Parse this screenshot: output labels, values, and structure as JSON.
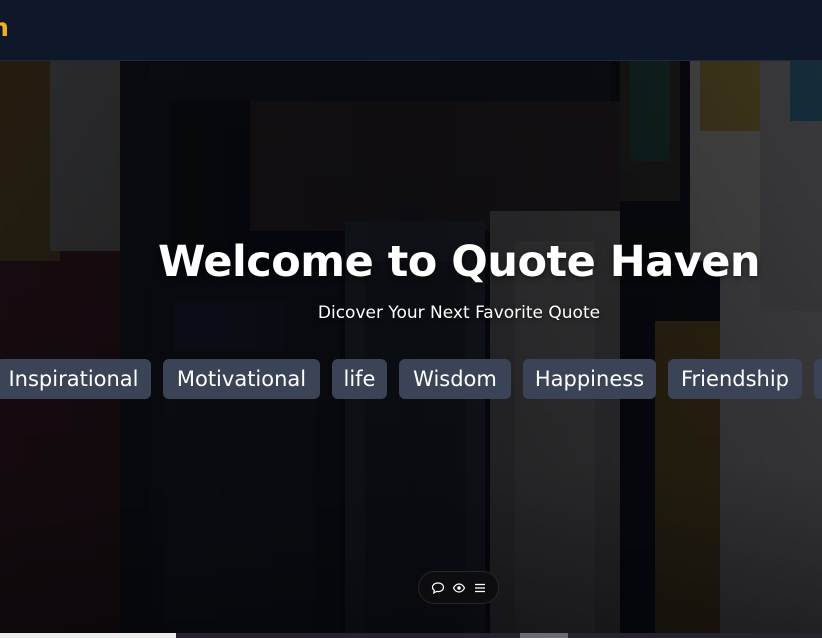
{
  "navbar": {
    "brand": "en"
  },
  "hero": {
    "title": "Welcome to Quote Haven",
    "subtitle": "Dicover Your Next Favorite Quote",
    "tags": [
      {
        "label": "Inspirational"
      },
      {
        "label": "Motivational"
      },
      {
        "label": "life"
      },
      {
        "label": "Wisdom"
      },
      {
        "label": "Happiness"
      },
      {
        "label": "Friendship"
      },
      {
        "label": ""
      }
    ]
  },
  "floating_toolbar": {
    "icons": [
      "comment-icon",
      "eye-icon",
      "menu-icon"
    ]
  },
  "colors": {
    "brand": "#f2b01e",
    "navbar_bg": "#0f172a",
    "tag_bg": "#3b4456"
  }
}
